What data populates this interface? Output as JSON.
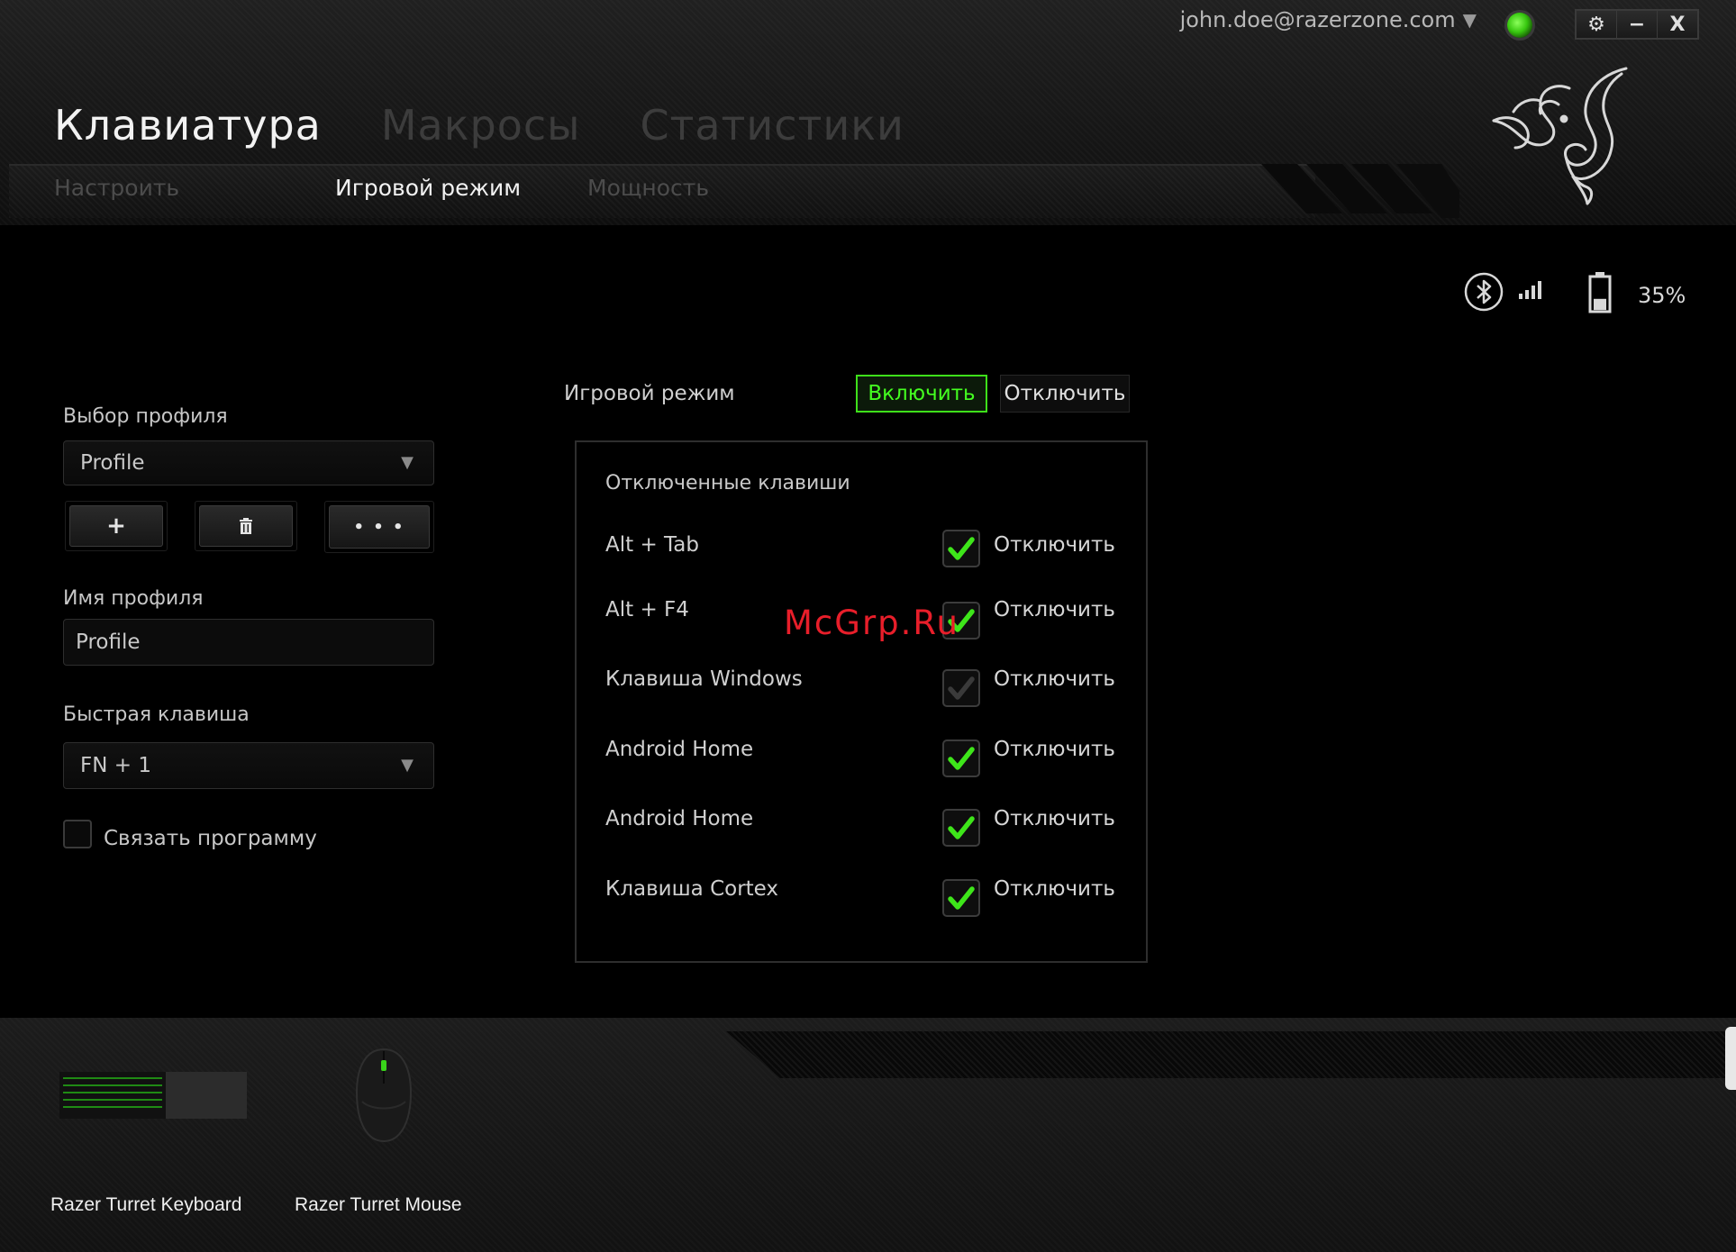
{
  "account": {
    "email": "john.doe@razerzone.com"
  },
  "window_buttons": {
    "settings": "⚙",
    "minimize": "−",
    "close": "X"
  },
  "tabs": [
    {
      "label": "Клавиатура",
      "active": true
    },
    {
      "label": "Макросы",
      "active": false
    },
    {
      "label": "Статистики",
      "active": false
    }
  ],
  "subtabs": [
    {
      "label": "Настроить",
      "active": false
    },
    {
      "label": "Игровой режим",
      "active": true
    },
    {
      "label": "Мощность",
      "active": false
    }
  ],
  "status": {
    "battery_text": "35%",
    "battery_level": 0.35
  },
  "profile": {
    "select_label": "Выбор профиля",
    "select_value": "Profile",
    "add_button": "+",
    "more_button": "• • •",
    "name_label": "Имя профиля",
    "name_value": "Profile",
    "hotkey_label": "Быстрая клавиша",
    "hotkey_value": "FN + 1",
    "link_program_label": "Связать программу",
    "link_program_checked": false
  },
  "game_mode": {
    "label": "Игровой режим",
    "enable_button": "Включить",
    "disable_button": "Отключить",
    "enabled": true,
    "disabled_keys_title": "Отключенные клавиши",
    "keys": [
      {
        "name": "Alt + Tab",
        "action": "Отключить",
        "checked": true
      },
      {
        "name": "Alt + F4",
        "action": "Отключить",
        "checked": true
      },
      {
        "name": "Клавиша Windows",
        "action": "Отключить",
        "checked": true,
        "dim": true
      },
      {
        "name": "Android Home",
        "action": "Отключить",
        "checked": true
      },
      {
        "name": "Android Home",
        "action": "Отключить",
        "checked": true
      },
      {
        "name": "Клавиша Cortex",
        "action": "Отключить",
        "checked": true
      }
    ]
  },
  "watermark": "McGrp.Ru",
  "devices": [
    {
      "name": "Razer Turret Keyboard"
    },
    {
      "name": "Razer Turret Mouse"
    }
  ],
  "colors": {
    "accent_green": "#44ff20",
    "background": "#000000"
  }
}
